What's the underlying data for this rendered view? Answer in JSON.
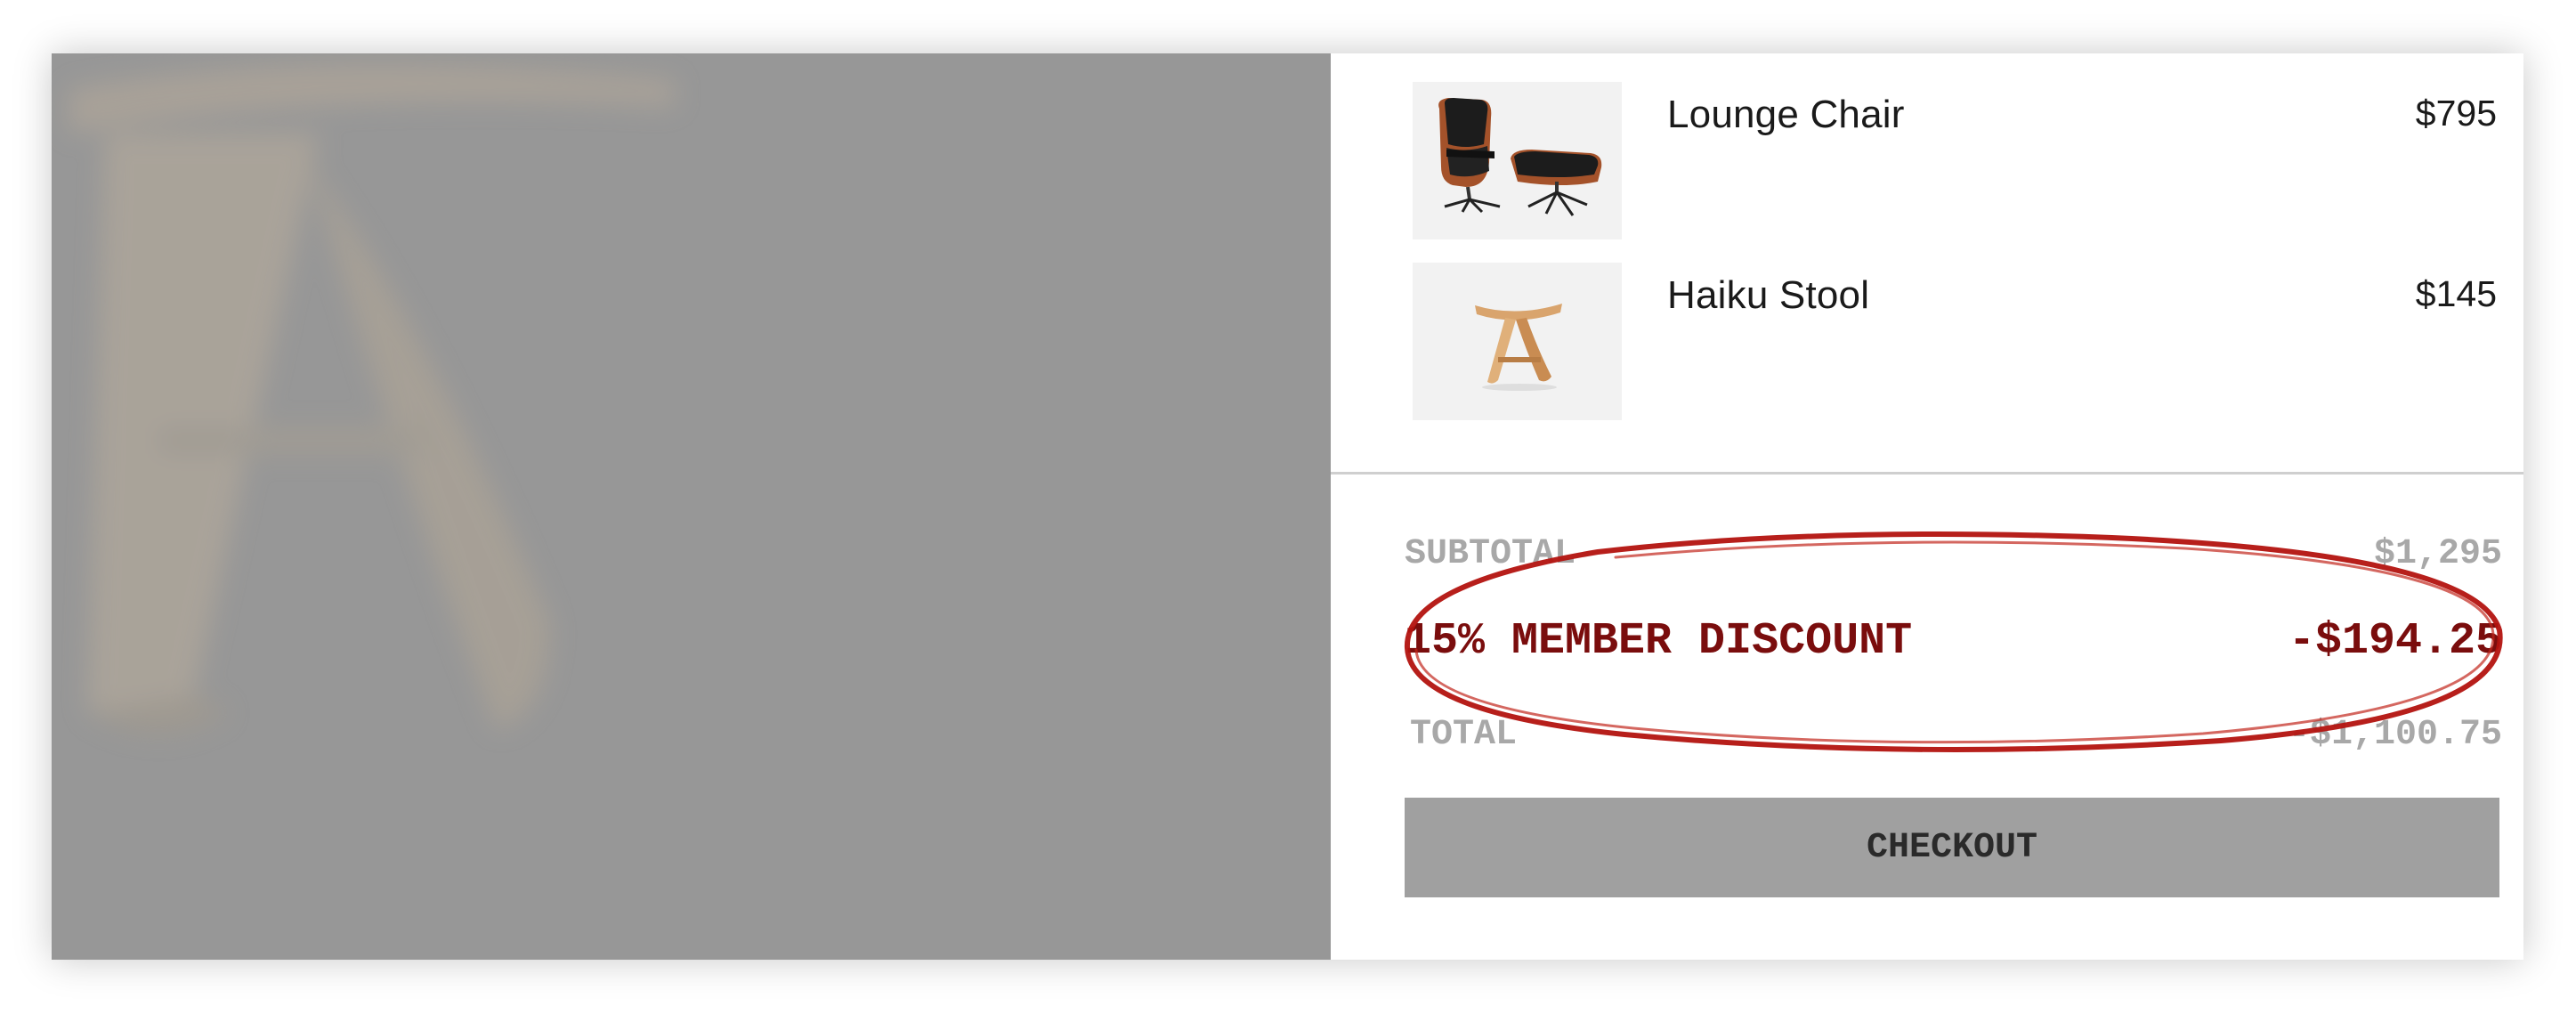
{
  "cart": {
    "items": [
      {
        "name": "Lounge Chair",
        "price": "$795",
        "thumbnail_icon": "lounge-chair-icon"
      },
      {
        "name": "Haiku Stool",
        "price": "$145",
        "thumbnail_icon": "haiku-stool-icon"
      }
    ],
    "summary": {
      "subtotal_label": "SUBTOTAL",
      "subtotal_value": "$1,295",
      "discount_label": "15% MEMBER DISCOUNT",
      "discount_value": "-$194.25",
      "total_label": "TOTAL",
      "total_value": "-$1,100.75"
    },
    "checkout_label": "CHECKOUT"
  },
  "colors": {
    "discount_text": "#7a0d0d",
    "annotation_circle": "#b3130f",
    "checkout_button": "#a0a0a0",
    "overlay": "#979797"
  }
}
